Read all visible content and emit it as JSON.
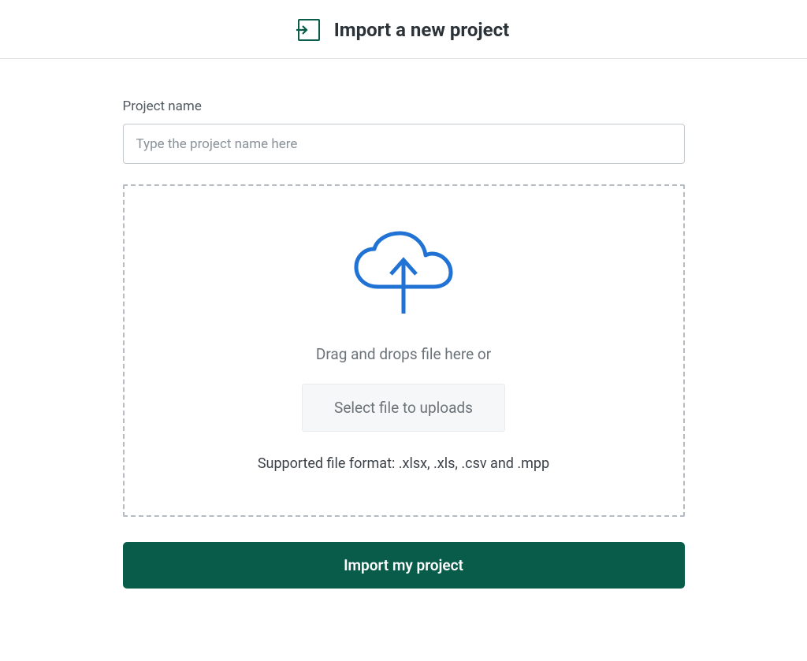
{
  "header": {
    "title": "Import a new project"
  },
  "form": {
    "project_name_label": "Project name",
    "project_name_placeholder": "Type the project name here"
  },
  "dropzone": {
    "instruction": "Drag and drops file here or",
    "select_button_label": "Select file to uploads",
    "supported_formats": "Supported file format: .xlsx, .xls, .csv and .mpp"
  },
  "actions": {
    "import_button_label": "Import my project"
  },
  "colors": {
    "accent": "#0a5c4a",
    "cloud_icon": "#2073d4"
  }
}
